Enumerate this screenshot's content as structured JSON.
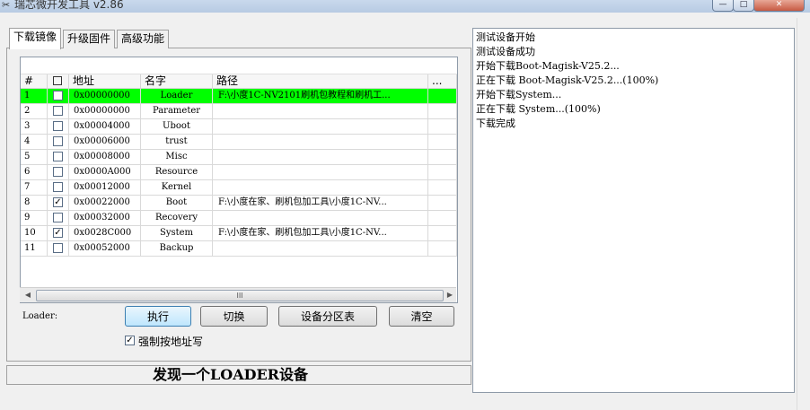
{
  "window": {
    "title": "瑞芯微开发工具 v2.86",
    "min_glyph": "—",
    "max_glyph": "□",
    "close_glyph": "✕"
  },
  "tabs": [
    {
      "label": "下载镜像",
      "active": true
    },
    {
      "label": "升级固件",
      "active": false
    },
    {
      "label": "高级功能",
      "active": false
    }
  ],
  "table": {
    "headers": {
      "num": "#",
      "check": "",
      "addr": "地址",
      "name": "名字",
      "path": "路径",
      "more": "..."
    },
    "rows": [
      {
        "num": "1",
        "checked": false,
        "addr": "0x00000000",
        "name": "Loader",
        "path": "F:\\小度1C-NV2101刷机包教程和刷机工...",
        "highlight": true
      },
      {
        "num": "2",
        "checked": false,
        "addr": "0x00000000",
        "name": "Parameter",
        "path": ""
      },
      {
        "num": "3",
        "checked": false,
        "addr": "0x00004000",
        "name": "Uboot",
        "path": ""
      },
      {
        "num": "4",
        "checked": false,
        "addr": "0x00006000",
        "name": "trust",
        "path": ""
      },
      {
        "num": "5",
        "checked": false,
        "addr": "0x00008000",
        "name": "Misc",
        "path": ""
      },
      {
        "num": "6",
        "checked": false,
        "addr": "0x0000A000",
        "name": "Resource",
        "path": ""
      },
      {
        "num": "7",
        "checked": false,
        "addr": "0x00012000",
        "name": "Kernel",
        "path": ""
      },
      {
        "num": "8",
        "checked": true,
        "addr": "0x00022000",
        "name": "Boot",
        "path": "F:\\小度在家、刷机包加工具\\小度1C-NV..."
      },
      {
        "num": "9",
        "checked": false,
        "addr": "0x00032000",
        "name": "Recovery",
        "path": ""
      },
      {
        "num": "10",
        "checked": true,
        "addr": "0x0028C000",
        "name": "System",
        "path": "F:\\小度在家、刷机包加工具\\小度1C-NV..."
      },
      {
        "num": "11",
        "checked": false,
        "addr": "0x00052000",
        "name": "Backup",
        "path": ""
      }
    ]
  },
  "scrollbar": {
    "left_arrow": "◀",
    "thumb_grip": "III",
    "right_arrow": "▶"
  },
  "controls": {
    "loader_label": "Loader:",
    "run": "执行",
    "switch": "切换",
    "partition": "设备分区表",
    "clear": "清空",
    "force_label": "强制按地址写",
    "force_checked": true
  },
  "status": "发现一个LOADER设备",
  "log": [
    "测试设备开始",
    "测试设备成功",
    "开始下载Boot-Magisk-V25.2...",
    "正在下载 Boot-Magisk-V25.2...(100%)",
    "开始下载System...",
    "正在下载 System...(100%)",
    "下载完成"
  ],
  "colors": {
    "highlight_row": "#00ff00"
  }
}
